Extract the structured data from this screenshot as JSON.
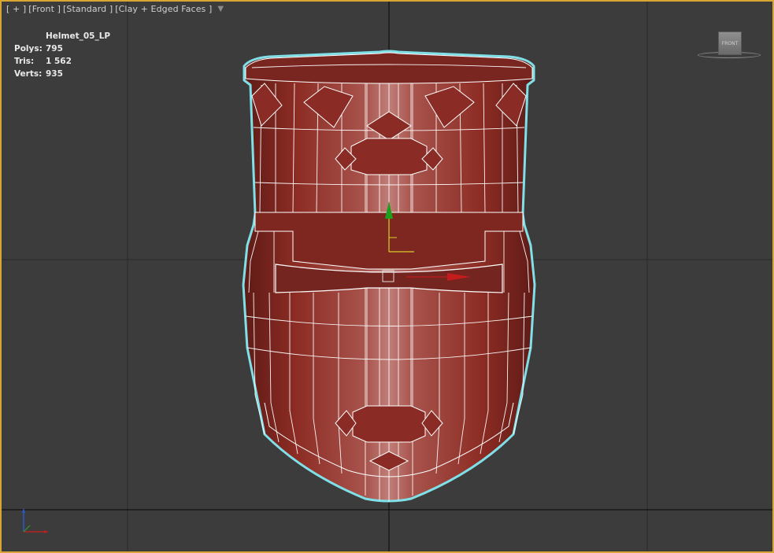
{
  "viewport": {
    "label_plus": "[ + ]",
    "label_view": "[Front ]",
    "label_shading_std": "[Standard ]",
    "label_shading_mode": "[Clay + Edged Faces ]",
    "filter_icon": "funnel-icon"
  },
  "stats": {
    "object_name": "Helmet_05_LP",
    "polys_label": "Polys:",
    "polys_value": "795",
    "tris_label": "Tris:",
    "tris_value": "1 562",
    "verts_label": "Verts:",
    "verts_value": "935"
  },
  "viewcube": {
    "face_label": "FRONT"
  },
  "colors": {
    "background": "#3c3c3c",
    "active_border": "#d8a733",
    "mesh_fill": "#8e2d24",
    "selection_outline": "#7fe0e8",
    "wire": "#ffffff"
  }
}
